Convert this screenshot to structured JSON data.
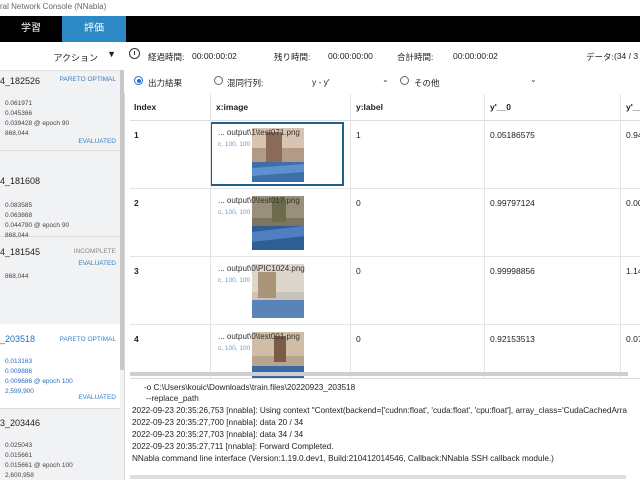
{
  "window": {
    "title": "ral Network Console (NNabla)"
  },
  "nav": {
    "tabs": [
      {
        "label": "学習"
      },
      {
        "label": "評価"
      }
    ]
  },
  "sidebar": {
    "action_label": "アクション",
    "cards": [
      {
        "name": "4_182526",
        "status": "PARETO OPTIMAL",
        "metrics": [
          "0.061971",
          "0.045366",
          "0.039428 @ epoch 90",
          "868,044"
        ],
        "badge": "EVALUATED"
      },
      {
        "name": "4_181608",
        "status": "",
        "metrics": [
          "0.083585",
          "0.063868",
          "0.044790 @ epoch 90",
          "868,044"
        ],
        "badge": "EVALUATED"
      },
      {
        "name": "4_181545",
        "status": "INCOMPLETE",
        "metrics": [
          "868,044"
        ],
        "badge": ""
      },
      {
        "name": "_203518",
        "status": "PARETO OPTIMAL",
        "metrics": [
          "0.013163",
          "0.009886",
          "0.009686 @ epoch 100",
          "2,599,900"
        ],
        "badge": "EVALUATED"
      },
      {
        "name": "3_203446",
        "status": "",
        "metrics": [
          "0.025043",
          "0.015661",
          "0.015661 @ epoch 100",
          "2,600,958"
        ],
        "badge": "EVALUATED"
      }
    ]
  },
  "timebar": {
    "elapsed_label": "経過時間:",
    "elapsed": "00:00:00:02",
    "remaining_label": "残り時間:",
    "remaining": "00:00:00:00",
    "total_label": "合計時間:",
    "total": "00:00:00:02",
    "data_label": "データ:",
    "data_value": "(34 / 3"
  },
  "options": {
    "output_label": "出力結果",
    "confusion_label": "混同行列:",
    "confusion_value": "y - y'",
    "other_label": "その他"
  },
  "table": {
    "columns": [
      "Index",
      "x:image",
      "y:label",
      "y'__0",
      "y'__"
    ],
    "rows": [
      {
        "index": "1",
        "file": "... output\\1\\test071.png",
        "shape": "c, 100, 100",
        "label": "1",
        "y0": "0.05186575",
        "y1": "0.94"
      },
      {
        "index": "2",
        "file": "... output\\0\\test017.png",
        "shape": "c, 100, 100",
        "label": "0",
        "y0": "0.99797124",
        "y1": "0.00"
      },
      {
        "index": "3",
        "file": "... output\\0\\PIC1024.png",
        "shape": "c, 100, 100",
        "label": "0",
        "y0": "0.99998856",
        "y1": "1.14"
      },
      {
        "index": "4",
        "file": "... output\\0\\test001.png",
        "shape": "c, 100, 100",
        "label": "0",
        "y0": "0.92153513",
        "y1": "0.07"
      }
    ]
  },
  "console": {
    "lines": [
      "-o  C:\\Users\\kouic\\Downloads\\train.files\\20220923_203518",
      "--replace_path",
      "2022-09-23 20:35:26,753 [nnabla]: Using context \"Context(backend=['cudnn:float', 'cuda:float', 'cpu:float'], array_class='CudaCachedArra",
      "2022-09-23 20:35:27,700 [nnabla]: data 20 / 34",
      "2022-09-23 20:35:27,703 [nnabla]: data 34 / 34",
      "2022-09-23 20:35:27,711 [nnabla]: Forward Completed.",
      "NNabla command line interface (Version:1.19.0.dev1, Build:210412014546, Callback:NNabla SSH callback module.)"
    ]
  }
}
